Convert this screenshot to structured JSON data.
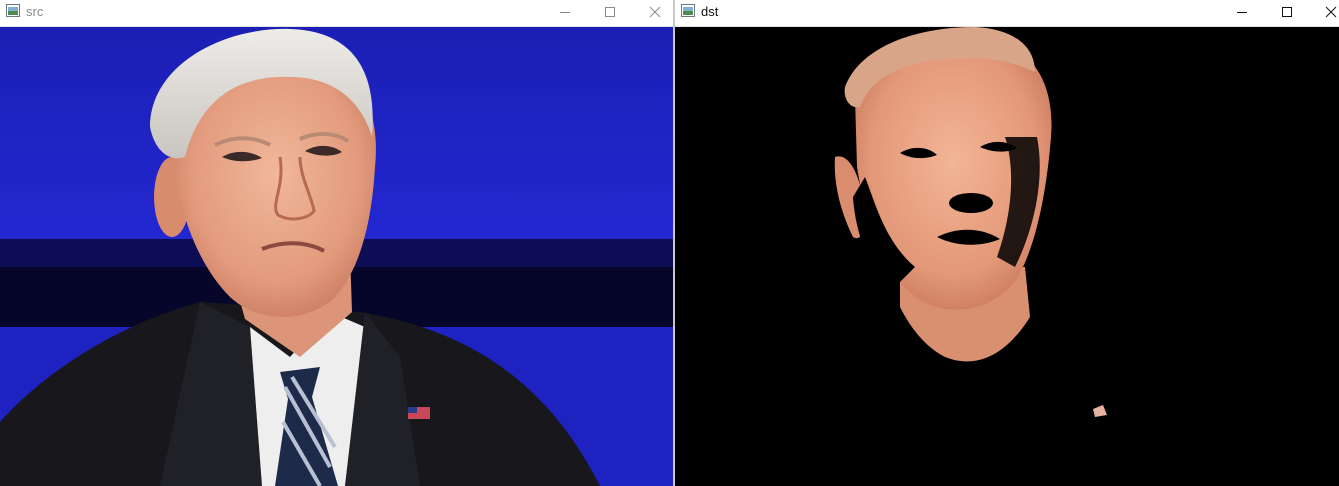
{
  "windows": {
    "src": {
      "title": "src",
      "icon": "opencv-window-icon",
      "controls": [
        "minimize-icon",
        "maximize-icon",
        "close-icon"
      ]
    },
    "dst": {
      "title": "dst",
      "icon": "opencv-window-icon",
      "controls": [
        "minimize-icon",
        "maximize-icon",
        "close-icon"
      ]
    }
  },
  "colors": {
    "src_background": "#1a20c8",
    "dst_background": "#000000",
    "skin": "#e9a27c",
    "hair": "#d9d6d2",
    "suit": "#1a1a1f",
    "shirt": "#f1f1f1",
    "tie": "#1e2a4a"
  }
}
